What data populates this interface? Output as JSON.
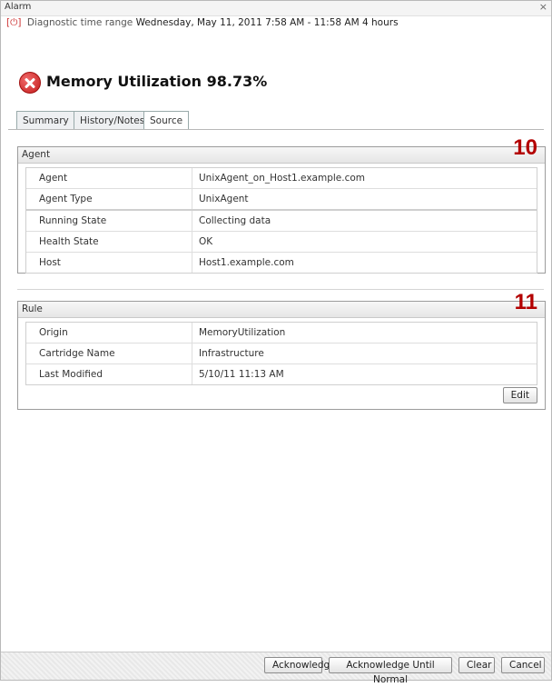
{
  "window": {
    "title": "Alarm",
    "close_glyph": "×"
  },
  "timebar": {
    "icon": "clock-icon",
    "label": "Diagnostic time range",
    "range": "Wednesday, May 11, 2011  7:58 AM - 11:58 AM",
    "duration": "4 hours"
  },
  "alarm": {
    "icon": "error-icon",
    "title": "Memory Utilization 98.73%",
    "colors": {
      "error": "#d22525",
      "callout": "#b30000"
    }
  },
  "tabs": [
    {
      "label": "Summary",
      "selected": false
    },
    {
      "label": "History/Notes",
      "selected": false
    },
    {
      "label": "Source",
      "selected": true
    }
  ],
  "agent_section": {
    "header": "Agent",
    "callout": "10",
    "rows": [
      {
        "key": "Agent",
        "value": "UnixAgent_on_Host1.example.com"
      },
      {
        "key": "Agent Type",
        "value": "UnixAgent"
      },
      {
        "key": "Running State",
        "value": "Collecting data"
      },
      {
        "key": "Health State",
        "value": "OK"
      },
      {
        "key": "Host",
        "value": "Host1.example.com"
      }
    ]
  },
  "rule_section": {
    "header": "Rule",
    "callout": "11",
    "rows": [
      {
        "key": "Origin",
        "value": "MemoryUtilization"
      },
      {
        "key": "Cartridge Name",
        "value": "Infrastructure"
      },
      {
        "key": "Last Modified",
        "value": "5/10/11 11:13 AM"
      }
    ],
    "edit_label": "Edit"
  },
  "footer": {
    "acknowledge": "Acknowledge",
    "acknowledge_until_normal": "Acknowledge Until Normal",
    "clear": "Clear",
    "cancel": "Cancel"
  }
}
